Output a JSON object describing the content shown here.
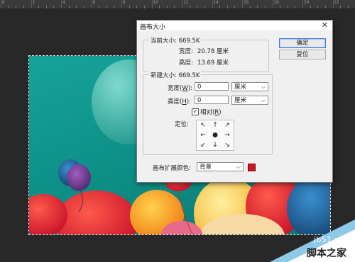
{
  "ruler": {
    "labels": [
      "0",
      "2",
      "4",
      "6",
      "8",
      "10",
      "12",
      "14",
      "16",
      "18",
      "20",
      "22"
    ]
  },
  "dialog": {
    "title": "画布大小",
    "close_symbol": "✕",
    "current": {
      "legend": "当前大小: 669.5K",
      "width_label": "宽度:",
      "width_value": "20.78 厘米",
      "height_label": "高度:",
      "height_value": "13.69 厘米"
    },
    "new": {
      "legend": "新建大小: 669.5K",
      "width_label_pre": "宽度(",
      "width_label_key": "W",
      "width_label_post": "):",
      "width_value": "0",
      "width_unit": "厘米",
      "height_label_pre": "高度(",
      "height_label_key": "H",
      "height_label_post": "):",
      "height_value": "0",
      "height_unit": "厘米",
      "relative_pre": "相对(",
      "relative_key": "R",
      "relative_post": ")",
      "relative_checked": true,
      "anchor_label": "定位:",
      "anchors": [
        "↖",
        "↑",
        "↗",
        "←",
        "●",
        "→",
        "↙",
        "↓",
        "↘"
      ]
    },
    "extension": {
      "label": "画布扩展颜色:",
      "value": "背景",
      "swatch_color": "#d4141e"
    },
    "buttons": {
      "ok": "确定",
      "reset": "复位"
    }
  },
  "watermark": {
    "url": "jb51.net",
    "name": "脚本之家"
  }
}
